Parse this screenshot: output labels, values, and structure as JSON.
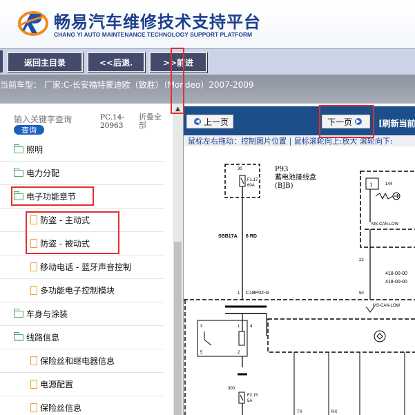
{
  "header": {
    "title": "畅易汽车维修技术支持平台",
    "subtitle": "CHANG YI AUTO MAINTENANCE TECHNOLOGY SUPPORT PLATFORM"
  },
  "toolbar": {
    "home_label": "返回主目录",
    "back_label": "<<后退.",
    "forward_label": ">>前进"
  },
  "car": {
    "label": "当前车型：  厂家:C-长安福特蒙迪欧（致胜）（Mondeo）2007-2009"
  },
  "sidebar": {
    "search_placeholder": "输入关键字查询",
    "search_button": "查询",
    "doc_code": "PC.14-20963",
    "collapse_all": "折叠全部",
    "items": [
      {
        "label": "照明",
        "type": "folder"
      },
      {
        "label": "电力分配",
        "type": "folder"
      },
      {
        "label": "电子功能章节",
        "type": "folder-open"
      },
      {
        "label": "防盗 - 主动式",
        "type": "doc"
      },
      {
        "label": "防盗 - 被动式",
        "type": "doc"
      },
      {
        "label": "移动电话 - 蓝牙声音控制",
        "type": "doc"
      },
      {
        "label": "多功能电子控制模块",
        "type": "doc"
      },
      {
        "label": "车身与涂装",
        "type": "folder"
      },
      {
        "label": "线路信息",
        "type": "folder-open"
      },
      {
        "label": "保险丝和继电器信息",
        "type": "doc"
      },
      {
        "label": "电源配置",
        "type": "doc"
      },
      {
        "label": "保险丝信息",
        "type": "doc"
      }
    ]
  },
  "viewer": {
    "prev_label": "上一页",
    "next_label": "下一页",
    "refresh_label": "[刷新当前",
    "hint": "鼠标左右拖动：控制图片位置 | 鼠标滚轮向上:放大  滚轮向下:"
  },
  "diagram": {
    "p93": "P93",
    "battery_label": "蓄电池接线盒",
    "bjb": "(BJB)",
    "fuse_f1": "F1.17",
    "fuse_f1_rating": "60A",
    "num_30": "30",
    "wire_sbb": "SBB17A",
    "wire_rd": "6 RD",
    "connector": "C1BP02-G",
    "pin_1": "1",
    "num_144": "144",
    "num_22": "22",
    "num_50": "50",
    "ms_can_low": "MS-CAN-LOW",
    "ms_can_low2": "MS-CAN-LOW",
    "code_418a": "418-00-00",
    "code_418b": "418-00-00",
    "n3": "3",
    "n1": "1",
    "n4": "4",
    "n2": "2",
    "n5": "5",
    "n300": "300",
    "fuse_f2": "F2.15",
    "fuse_f2_rating": "5A",
    "tx": "TX",
    "rx": "RX"
  },
  "colors": {
    "brand_blue": "#1d3f8f",
    "toolbar_button": "#434a6a",
    "viewer_bar": "#1d4e8a",
    "highlight": "#e03030"
  }
}
